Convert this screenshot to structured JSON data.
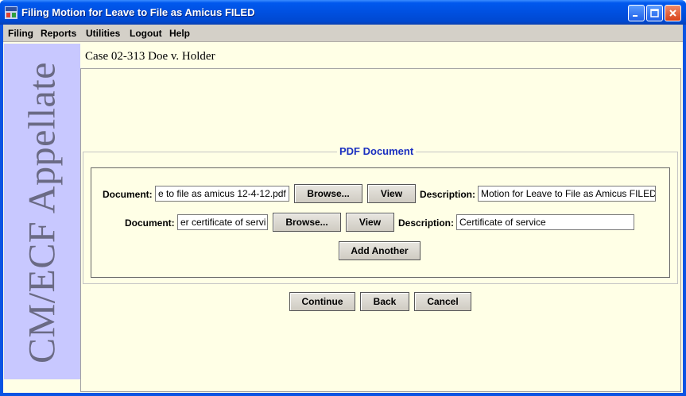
{
  "window": {
    "title": "Filing Motion for Leave to File as Amicus FILED",
    "icon": "app-icon"
  },
  "menu": {
    "items": [
      "Filing",
      "Reports",
      "Utilities",
      "Logout",
      "Help"
    ]
  },
  "sidebar": {
    "brand": "CM/ECF Appellate",
    "color": "#c8c8ff"
  },
  "case": {
    "title": "Case 02-313 Doe v. Holder"
  },
  "pdf_section": {
    "title": "PDF Document",
    "rows": [
      {
        "document_label": "Document:",
        "document_value": "e to file as amicus 12-4-12.pdf",
        "browse_label": "Browse...",
        "view_label": "View",
        "description_label": "Description:",
        "description_value": "Motion for Leave to File as Amicus FILED"
      },
      {
        "document_label": "Document:",
        "document_value": "er certificate of servi",
        "browse_label": "Browse...",
        "view_label": "View",
        "description_label": "Description:",
        "description_value": "Certificate of service"
      }
    ],
    "add_another_label": "Add Another"
  },
  "actions": {
    "continue_label": "Continue",
    "back_label": "Back",
    "cancel_label": "Cancel"
  },
  "colors": {
    "titlebar": "#0050e0",
    "content_bg": "#ffffe6",
    "group_title": "#1a2fc0"
  }
}
